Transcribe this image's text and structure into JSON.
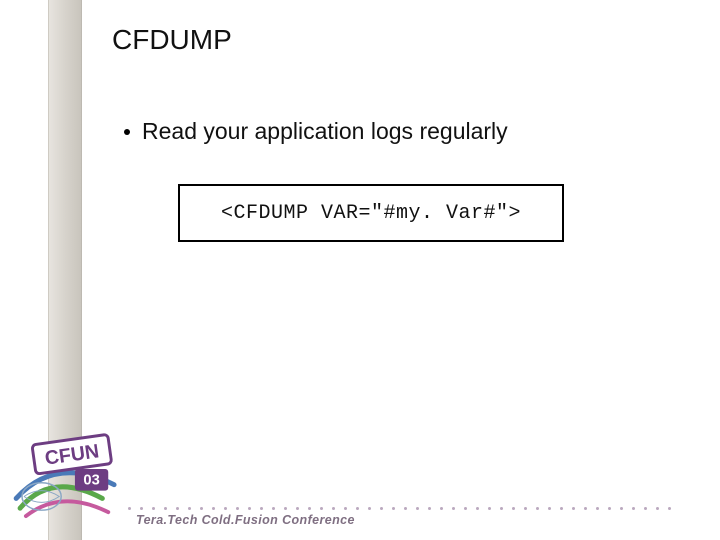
{
  "slide": {
    "title": "CFDUMP",
    "bullet": "Read your application logs regularly",
    "code": "<CFDUMP VAR=\"#my. Var#\">",
    "footer": "Tera.Tech Cold.Fusion Conference",
    "logo": {
      "brand": "CFUN",
      "year": "03"
    },
    "colors": {
      "stripe": "#d7d3cc",
      "logo_purple": "#6d3d82",
      "logo_green": "#5aa84a",
      "logo_blue": "#4a7ab8",
      "footer_text": "#7f6f82"
    }
  }
}
